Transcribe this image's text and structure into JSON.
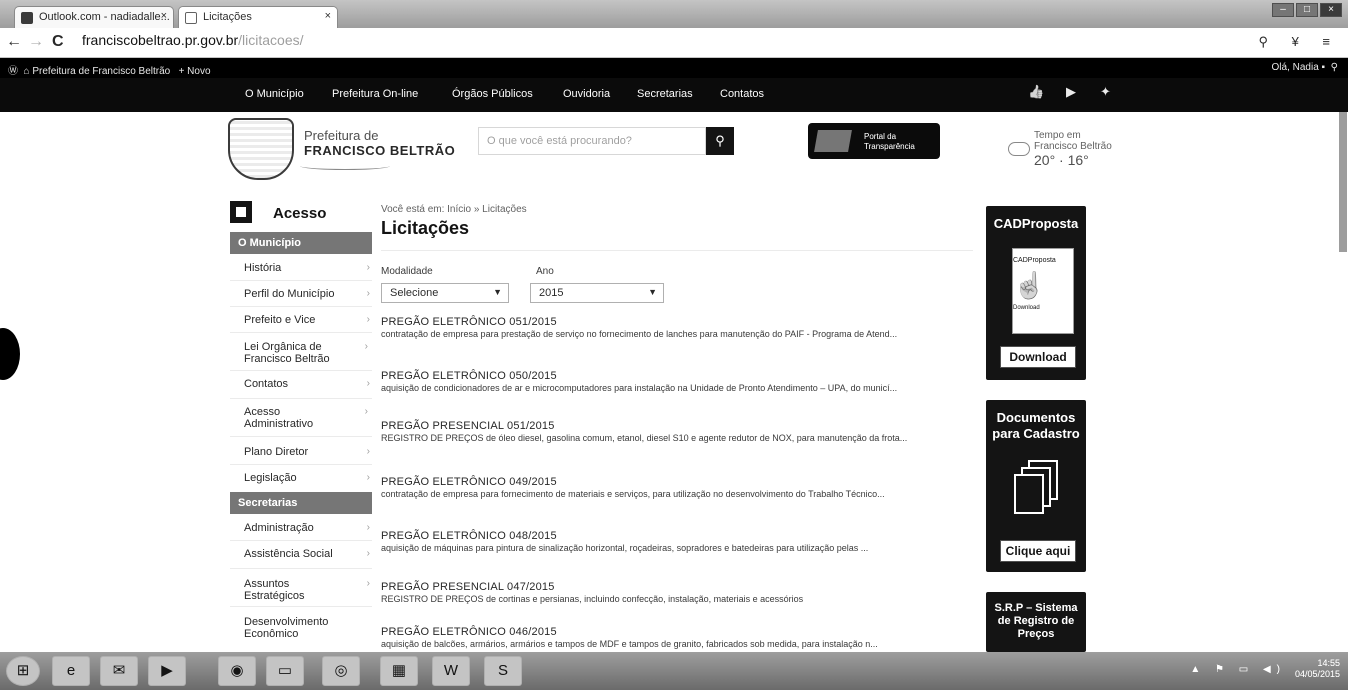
{
  "browser": {
    "tabs": [
      {
        "label": "Outlook.com - nadiadalle..."
      },
      {
        "label": "Licitações"
      }
    ],
    "url_main": "franciscobeltrao.pr.gov.br",
    "url_path": "/licitacoes/"
  },
  "wpbar": {
    "site": "Prefeitura de Francisco Beltrão",
    "new": "+ Novo",
    "greeting": "Olá, Nadia"
  },
  "nav": {
    "items": [
      "O Município",
      "Prefeitura On-line",
      "Órgãos Públicos",
      "Ouvidoria",
      "Secretarias",
      "Contatos"
    ]
  },
  "header": {
    "logo_line1": "Prefeitura de",
    "logo_line2": "FRANCISCO BELTRÃO",
    "search_placeholder": "O que você está procurando?",
    "portal_line1": "Portal da",
    "portal_line2": "Transparência",
    "weather_line1": "Tempo em",
    "weather_line2": "Francisco Beltrão",
    "weather_temp": "20° · 16°"
  },
  "sidebar": {
    "title": "Acesso",
    "head1": "O Município",
    "group1": [
      "História",
      "Perfil do Município",
      "Prefeito e Vice",
      "Lei Orgânica de Francisco Beltrão",
      "Contatos",
      "Acesso Administrativo",
      "Plano Diretor",
      "Legislação"
    ],
    "head2": "Secretarias",
    "group2": [
      "Administração",
      "Assistência Social",
      "Assuntos Estratégicos",
      "Desenvolvimento Econômico"
    ]
  },
  "main": {
    "breadcrumb": "Você está em: Início » Licitações",
    "title": "Licitações",
    "filter_modalidade_label": "Modalidade",
    "filter_modalidade_value": "Selecione",
    "filter_ano_label": "Ano",
    "filter_ano_value": "2015",
    "entries": [
      {
        "title": "PREGÃO ELETRÔNICO 051/2015",
        "desc": "contratação de empresa para prestação de serviço no fornecimento de lanches para manutenção do PAIF - Programa de Atend..."
      },
      {
        "title": "PREGÃO ELETRÔNICO 050/2015",
        "desc": "aquisição de condicionadores de ar e microcomputadores para instalação na Unidade de Pronto Atendimento – UPA, do municí..."
      },
      {
        "title": "PREGÃO PRESENCIAL 051/2015",
        "desc": "REGISTRO DE PREÇOS de óleo diesel, gasolina comum, etanol, diesel S10 e agente redutor de NOX, para manutenção da frota..."
      },
      {
        "title": "PREGÃO ELETRÔNICO 049/2015",
        "desc": "contratação de empresa para fornecimento de materiais e serviços, para utilização no desenvolvimento do Trabalho Técnico..."
      },
      {
        "title": "PREGÃO ELETRÔNICO 048/2015",
        "desc": "aquisição de máquinas para pintura de sinalização horizontal, roçadeiras, sopradores e batedeiras para utilização pelas ..."
      },
      {
        "title": "PREGÃO PRESENCIAL 047/2015",
        "desc": "REGISTRO DE PREÇOS de cortinas e persianas, incluindo confecção, instalação, materiais e acessórios"
      },
      {
        "title": "PREGÃO ELETRÔNICO 046/2015",
        "desc": "aquisição de balcões, armários, armários e tampos de MDF e tampos de granito, fabricados sob medida, para instalação n..."
      }
    ]
  },
  "right": {
    "cad_title": "CADProposta",
    "cad_box_title": "CADProposta",
    "cad_box_sub": "Download",
    "cad_button": "Download",
    "docs_title_1": "Documentos",
    "docs_title_2": "para Cadastro",
    "docs_button": "Clique aqui",
    "srp_title": "S.R.P – Sistema de Registro de Preços"
  },
  "taskbar": {
    "time": "14:55",
    "date": "04/05/2015"
  }
}
